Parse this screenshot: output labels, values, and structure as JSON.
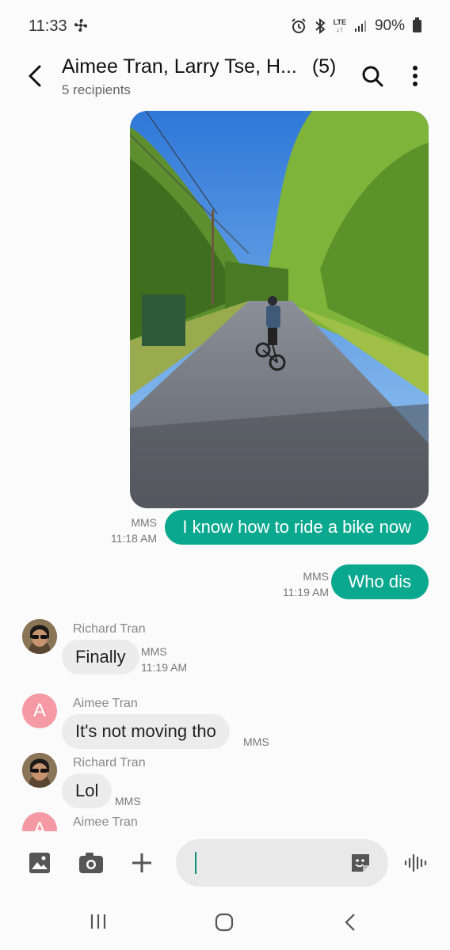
{
  "status": {
    "time": "11:33",
    "network": "LTE",
    "battery": "90%"
  },
  "header": {
    "title": "Aimee Tran, Larry Tse, H...",
    "count": "(5)",
    "subtitle": "5 recipients"
  },
  "messages": {
    "m1": {
      "type": "MMS",
      "time": "11:18 AM",
      "text": "I know how to ride a bike now"
    },
    "m2": {
      "type": "MMS",
      "time": "11:19 AM",
      "text": "Who dis"
    },
    "m3": {
      "sender": "Richard Tran",
      "text": "Finally",
      "type": "MMS",
      "time": "11:19 AM"
    },
    "m4": {
      "sender": "Aimee Tran",
      "avatar_letter": "A",
      "text": "It's not moving tho",
      "type": "MMS"
    },
    "m5": {
      "sender": "Richard Tran",
      "text": "Lol",
      "type": "MMS"
    },
    "m6": {
      "sender": "Aimee Tran",
      "avatar_letter": "A"
    }
  },
  "composer": {
    "placeholder": ""
  },
  "colors": {
    "accent": "#0aa88f",
    "incoming_bubble": "#ececec",
    "avatar_a": "#f59aa4"
  },
  "icons": [
    "fan-icon",
    "alarm-icon",
    "bluetooth-icon",
    "signal-icon",
    "battery-icon",
    "back-arrow-icon",
    "search-icon",
    "more-vert-icon",
    "gallery-icon",
    "camera-icon",
    "plus-icon",
    "sticker-icon",
    "voice-icon",
    "recents-icon",
    "home-icon",
    "nav-back-icon"
  ]
}
